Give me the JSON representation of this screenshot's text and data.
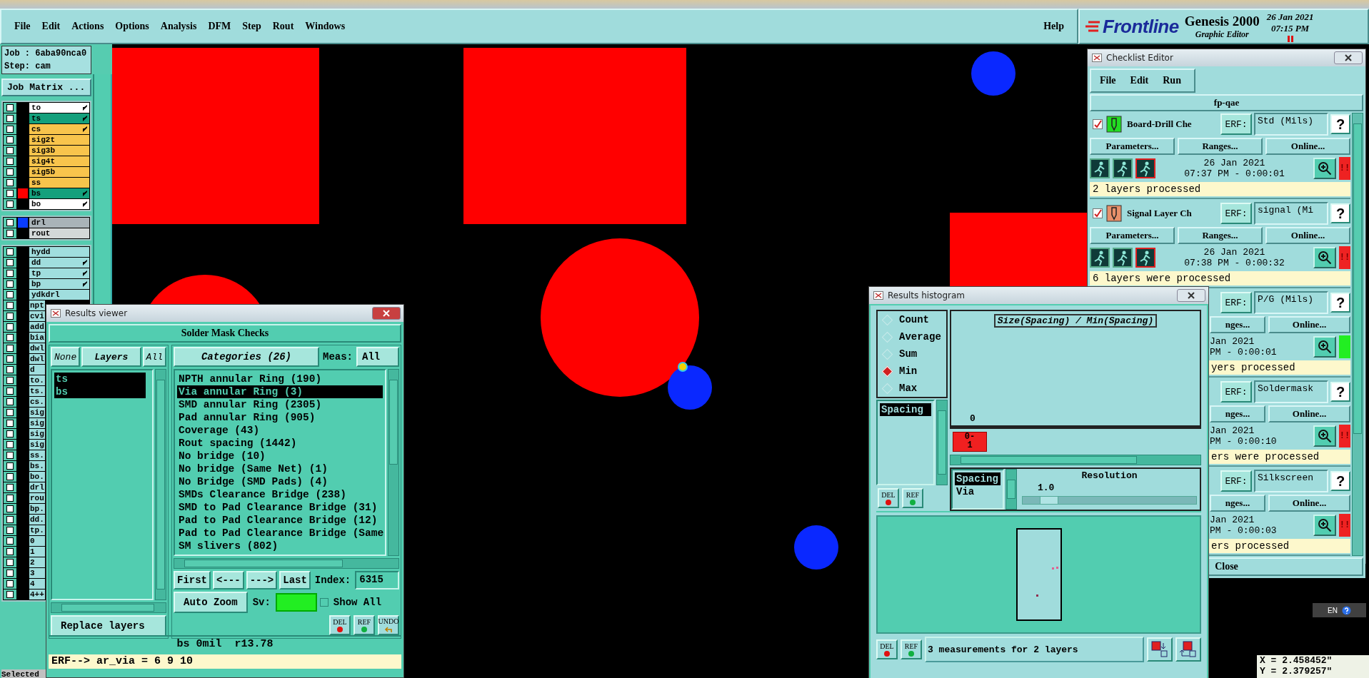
{
  "menu_bar": {
    "items": [
      {
        "label": "File"
      },
      {
        "label": "Edit"
      },
      {
        "label": "Actions"
      },
      {
        "label": "Options"
      },
      {
        "label": "Analysis"
      },
      {
        "label": "DFM"
      },
      {
        "label": "Step"
      },
      {
        "label": "Rout"
      },
      {
        "label": "Windows"
      }
    ],
    "help": "Help"
  },
  "brand": {
    "logo": "Frontline",
    "product": "Genesis 2000",
    "subtitle": "Graphic Editor",
    "date": "26 Jan 2021",
    "time": "07:15 PM"
  },
  "job_panel": {
    "job": "Job : 6aba90nca0",
    "step": "Step: cam",
    "matrix_button": "Job Matrix ..."
  },
  "layer_groups": [
    {
      "layers": [
        {
          "name": "to",
          "color": "#ffffff",
          "affected": true,
          "checked": false
        },
        {
          "name": "ts",
          "color": "#14a07c",
          "affected": true,
          "checked": false
        },
        {
          "name": "cs",
          "color": "#f8c44c",
          "affected": true,
          "checked": false
        },
        {
          "name": "sig2t",
          "color": "#f8c44c",
          "affected": false,
          "checked": false
        },
        {
          "name": "sig3b",
          "color": "#f8c44c",
          "affected": false,
          "checked": false
        },
        {
          "name": "sig4t",
          "color": "#f8c44c",
          "affected": false,
          "checked": false
        },
        {
          "name": "sig5b",
          "color": "#f8c44c",
          "affected": false,
          "checked": false
        },
        {
          "name": "ss",
          "color": "#f8c44c",
          "affected": false,
          "checked": false
        },
        {
          "name": "bs",
          "color": "#14a07c",
          "affected": true,
          "checked": false,
          "swatch": {
            "color": "#ff0000"
          }
        },
        {
          "name": "bo",
          "color": "#ffffff",
          "affected": true,
          "checked": false
        }
      ]
    },
    {
      "layers": [
        {
          "name": "drl",
          "color": "#a9b3b8",
          "affected": false,
          "checked": false,
          "swatch": {
            "color": "#0a3cff"
          }
        },
        {
          "name": "rout",
          "color": "#d3d8d8",
          "affected": false,
          "checked": false
        }
      ]
    },
    {
      "layers": [
        {
          "name": "hydd",
          "color": "#a0dede",
          "affected": false,
          "checked": false
        },
        {
          "name": "dd",
          "color": "#a0dede",
          "affected": true,
          "checked": false
        },
        {
          "name": "tp",
          "color": "#a0dede",
          "affected": true,
          "checked": false
        },
        {
          "name": "bp",
          "color": "#a0dede",
          "affected": true,
          "checked": false
        },
        {
          "name": "ydkdrl",
          "color": "#a0dede",
          "affected": false,
          "checked": false
        },
        {
          "name": "npt",
          "color": "#a0dede",
          "checked": false
        },
        {
          "name": "cvi",
          "color": "#a0dede",
          "checked": false
        },
        {
          "name": "add",
          "color": "#a0dede",
          "checked": false
        },
        {
          "name": "bia",
          "color": "#a0dede",
          "checked": false
        },
        {
          "name": "dwl",
          "color": "#a0dede",
          "checked": false
        },
        {
          "name": "dwl",
          "color": "#a0dede",
          "checked": false
        },
        {
          "name": "d",
          "color": "#a0dede",
          "checked": false
        },
        {
          "name": "to.",
          "color": "#a0dede",
          "checked": false
        },
        {
          "name": "ts.",
          "color": "#a0dede",
          "checked": false
        },
        {
          "name": "cs.",
          "color": "#a0dede",
          "checked": false
        },
        {
          "name": "sig",
          "color": "#a0dede",
          "checked": false
        },
        {
          "name": "sig",
          "color": "#a0dede",
          "checked": false
        },
        {
          "name": "sig",
          "color": "#a0dede",
          "checked": false
        },
        {
          "name": "sig",
          "color": "#a0dede",
          "checked": false
        },
        {
          "name": "ss.",
          "color": "#a0dede",
          "checked": false
        },
        {
          "name": "bs.",
          "color": "#a0dede",
          "checked": false
        },
        {
          "name": "bo.",
          "color": "#a0dede",
          "checked": false
        },
        {
          "name": "drl",
          "color": "#a0dede",
          "checked": false
        },
        {
          "name": "rou",
          "color": "#a0dede",
          "checked": false
        },
        {
          "name": "bp.",
          "color": "#a0dede",
          "checked": false
        },
        {
          "name": "dd.",
          "color": "#a0dede",
          "checked": false
        },
        {
          "name": "tp.",
          "color": "#a0dede",
          "checked": false
        },
        {
          "name": "0",
          "color": "#a0dede",
          "checked": false
        },
        {
          "name": "1",
          "color": "#a0dede",
          "checked": false
        },
        {
          "name": "2",
          "color": "#a0dede",
          "checked": false
        },
        {
          "name": "3",
          "color": "#a0dede",
          "checked": false
        },
        {
          "name": "4",
          "color": "#a0dede",
          "checked": false
        },
        {
          "name": "4++",
          "color": "#a0dede",
          "checked": false
        }
      ]
    }
  ],
  "status_fragment": "Selected",
  "results_viewer": {
    "title": "Results viewer",
    "heading": "Solder Mask Checks",
    "layer_buttons": [
      {
        "label": "None",
        "selected": false
      },
      {
        "label": "Layers",
        "selected": true
      },
      {
        "label": "All",
        "selected": false
      }
    ],
    "layers": [
      {
        "name": "ts",
        "selected": true
      },
      {
        "name": "bs",
        "selected": true
      }
    ],
    "categories_button": "Categories (26)",
    "meas_label": "Meas:",
    "meas_value": "All",
    "categories": [
      {
        "label": "NPTH annular Ring (190)",
        "selected": false
      },
      {
        "label": "Via annular Ring (3)",
        "selected": true
      },
      {
        "label": "SMD annular Ring (2305)",
        "selected": false
      },
      {
        "label": "Pad annular Ring (905)",
        "selected": false
      },
      {
        "label": "Coverage (43)",
        "selected": false
      },
      {
        "label": "Rout spacing (1442)",
        "selected": false
      },
      {
        "label": "No bridge (10)",
        "selected": false
      },
      {
        "label": "No bridge (Same Net) (1)",
        "selected": false
      },
      {
        "label": "No Bridge (SMD Pads) (4)",
        "selected": false
      },
      {
        "label": "SMDs Clearance Bridge (238)",
        "selected": false
      },
      {
        "label": "SMD to Pad Clearance Bridge (31)",
        "selected": false
      },
      {
        "label": "Pad to Pad Clearance Bridge (12)",
        "selected": false
      },
      {
        "label": "Pad to Pad Clearance Bridge (Same",
        "selected": false
      },
      {
        "label": "SM slivers (802)",
        "selected": false
      }
    ],
    "nav": [
      "First",
      "<---",
      "--->",
      "Last"
    ],
    "index_label": "Index:",
    "index_value": "6315",
    "zoom_mode": "Auto Zoom",
    "sv_label": "Sv:",
    "sv": {
      "color": "#22ee22"
    },
    "show_all": {
      "label": "Show All",
      "checked": false
    },
    "replace_mode": "Replace layers",
    "tools": [
      {
        "label": "DEL",
        "kind": "delete"
      },
      {
        "label": "REF",
        "kind": "reference"
      },
      {
        "label": "UNDO",
        "kind": "undo"
      }
    ],
    "status": "bs 0mil  r13.78",
    "erf": "ERF--> ar_via = 6 9 10"
  },
  "histogram": {
    "title": "Results histogram",
    "modes": [
      {
        "label": "Count",
        "selected": false
      },
      {
        "label": "Average",
        "selected": false
      },
      {
        "label": "Sum",
        "selected": false
      },
      {
        "label": "Min",
        "selected": true
      },
      {
        "label": "Max",
        "selected": false
      }
    ],
    "measures": [
      {
        "label": "Spacing",
        "selected": true
      }
    ],
    "list_tools": [
      {
        "label": "DEL",
        "kind": "delete"
      },
      {
        "label": "REF",
        "kind": "reference"
      }
    ],
    "chart_title": "Size(Spacing) / Min(Spacing)",
    "bin_count": "0",
    "bin_label": "0-1",
    "sub_list": [
      {
        "label": "Spacing",
        "selected": true
      },
      {
        "label": "Via",
        "selected": false
      }
    ],
    "resolution_label": "Resolution",
    "resolution_value": "1.0",
    "resolution_slider": {
      "level": 0.1
    },
    "tools": [
      {
        "label": "DEL",
        "kind": "delete"
      },
      {
        "label": "REF",
        "kind": "reference"
      }
    ],
    "summary": "3 measurements for 2 layers"
  },
  "checklist_editor": {
    "title": "Checklist Editor",
    "menu": [
      "File",
      "Edit",
      "Run"
    ],
    "checklist_name": "fp-qae",
    "checks": [
      {
        "kind": "full",
        "checked": true,
        "icon": {
          "color": "#22dd22"
        },
        "name": "Board-Drill Che",
        "erf_button": "ERF:",
        "erf": "Std (Mils)",
        "help": "?",
        "buttons": [
          "Parameters...",
          "Ranges...",
          "Online..."
        ],
        "date": "26 Jan 2021",
        "time": "07:37 PM - 0:00:01",
        "passed": false,
        "flag": "!!",
        "message": "2 layers processed"
      },
      {
        "kind": "full",
        "checked": true,
        "icon": {
          "color": "#e8906a"
        },
        "name": "Signal Layer Ch",
        "erf_button": "ERF:",
        "erf": "signal (Mi",
        "help": "?",
        "buttons": [
          "Parameters...",
          "Ranges...",
          "Online..."
        ],
        "date": "26 Jan 2021",
        "time": "07:38 PM - 0:00:32",
        "passed": false,
        "flag": "!!",
        "message": "6 layers were processed"
      },
      {
        "kind": "covered",
        "erf_button": "ERF:",
        "erf": "P/G (Mils)",
        "help": "?",
        "buttons": [
          "nges...",
          "Online..."
        ],
        "date": "Jan 2021",
        "time": "PM - 0:00:01",
        "passed": true,
        "message": "yers processed"
      },
      {
        "kind": "covered",
        "erf_button": "ERF:",
        "erf": "Soldermask",
        "help": "?",
        "buttons": [
          "nges...",
          "Online..."
        ],
        "date": "Jan 2021",
        "time": "PM - 0:00:10",
        "passed": false,
        "flag": "!!",
        "message": "ers were processed"
      },
      {
        "kind": "covered",
        "erf_button": "ERF:",
        "erf": "Silkscreen",
        "help": "?",
        "buttons": [
          "nges...",
          "Online..."
        ],
        "date": "Jan 2021",
        "time": "PM - 0:00:03",
        "passed": false,
        "flag": "!!",
        "message": "ers processed"
      }
    ],
    "close": "Close"
  },
  "coordinates": {
    "x": "X = 2.458452\"",
    "y": "Y = 2.379257\""
  },
  "language_bar": {
    "label": "EN"
  }
}
